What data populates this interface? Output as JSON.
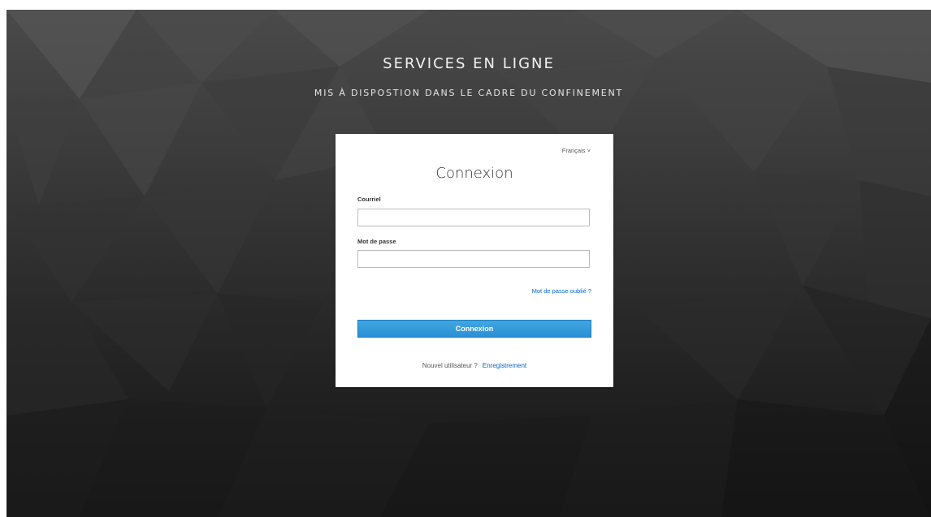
{
  "header": {
    "title": "SERVICES EN LIGNE",
    "subtitle": "MIS À DISPOSTION DANS LE CADRE DU CONFINEMENT"
  },
  "login": {
    "language": "Français ˅",
    "title": "Connexion",
    "email_label": "Courriel",
    "email_value": "",
    "password_label": "Mot de passe",
    "password_value": "",
    "forgot_password": "Mot de passe oublié ?",
    "submit_label": "Connexion",
    "new_user_text": "Nouvel utilisateur ?",
    "register_link": "Enregistrement"
  },
  "colors": {
    "background_light": "#4a4a4a",
    "background_dark": "#141414",
    "button_blue": "#2b8fd6",
    "link_blue": "#0066cc"
  }
}
